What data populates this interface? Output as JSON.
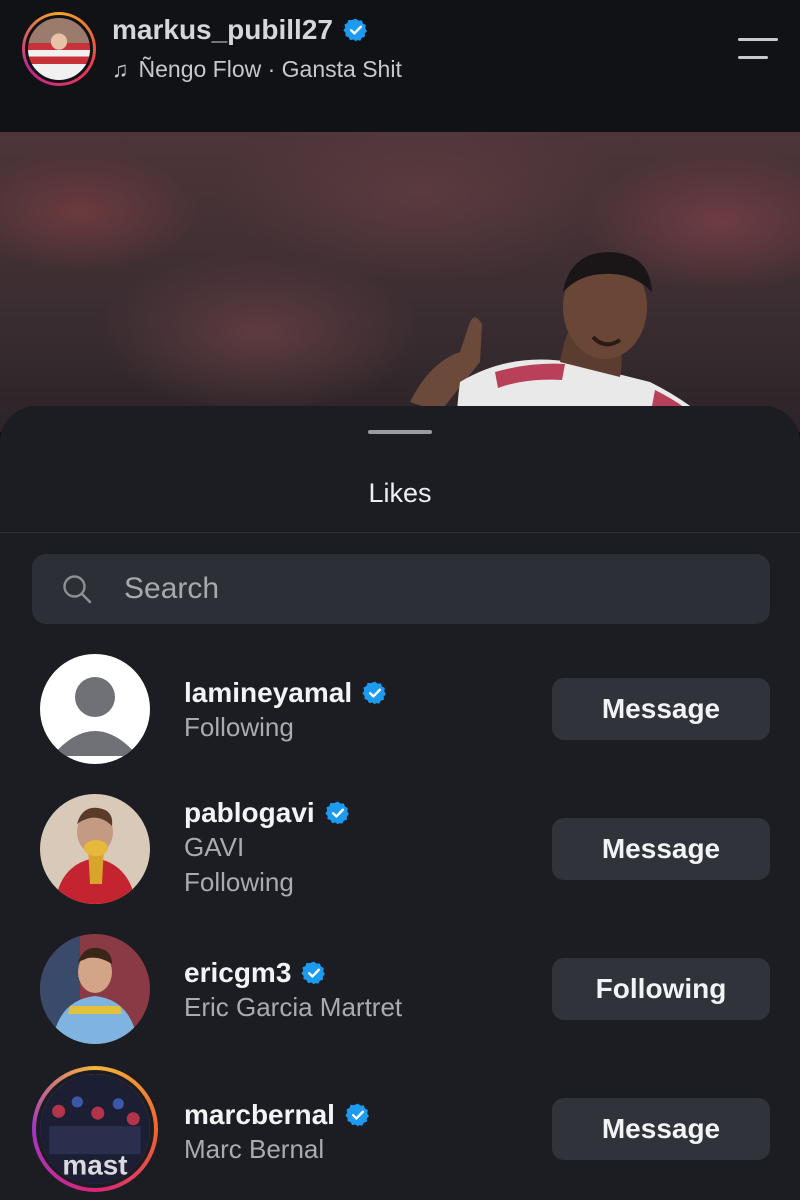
{
  "header": {
    "username": "markus_pubill27",
    "verified": true,
    "music_icon": "♫",
    "music": "Ñengo Flow · Gansta Shit",
    "menu_icon": "menu-icon"
  },
  "sheet": {
    "title": "Likes",
    "search_placeholder": "Search",
    "search_value": ""
  },
  "likes": [
    {
      "username": "lamineyamal",
      "verified": true,
      "line1": "Following",
      "line2": "",
      "button": "Message",
      "avatar": "default-avatar"
    },
    {
      "username": "pablogavi",
      "verified": true,
      "line1": "GAVI",
      "line2": "Following",
      "button": "Message",
      "avatar": "photo-avatar"
    },
    {
      "username": "ericgm3",
      "verified": true,
      "line1": "Eric Garcia Martret",
      "line2": "",
      "button": "Following",
      "avatar": "photo-avatar"
    },
    {
      "username": "marcbernal",
      "verified": true,
      "line1": "Marc Bernal",
      "line2": "",
      "button": "Message",
      "avatar": "story-ring-avatar",
      "avatar_text": "mast"
    }
  ],
  "colors": {
    "background": "#1b1d22",
    "verified_badge": "#1d9bf0",
    "button": "#30333a",
    "search_bg": "#2c2f36"
  }
}
